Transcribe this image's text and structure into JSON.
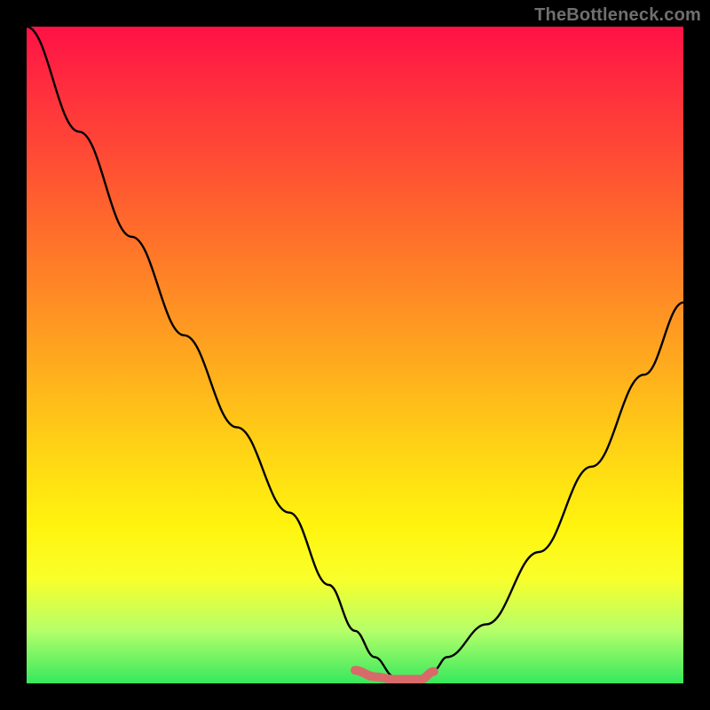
{
  "watermark": "TheBottleneck.com",
  "chart_data": {
    "type": "line",
    "title": "",
    "xlabel": "",
    "ylabel": "",
    "xlim": [
      0,
      100
    ],
    "ylim": [
      0,
      100
    ],
    "grid": false,
    "legend": false,
    "series": [
      {
        "name": "bottleneck-curve",
        "x": [
          0,
          8,
          16,
          24,
          32,
          40,
          46,
          50,
          53,
          56,
          60,
          62,
          64,
          70,
          78,
          86,
          94,
          100
        ],
        "values": [
          100,
          84,
          68,
          53,
          39,
          26,
          15,
          8,
          4,
          1,
          1,
          2,
          4,
          9,
          20,
          33,
          47,
          58
        ]
      },
      {
        "name": "sweet-range-marker",
        "x": [
          50,
          53,
          56,
          60,
          62
        ],
        "values": [
          2,
          1,
          0.6,
          0.6,
          1.8
        ]
      }
    ]
  },
  "colors": {
    "curve": "#000000",
    "marker": "#d86a6a",
    "frame_bg_top": "#ff1146",
    "frame_bg_bottom": "#36e85e",
    "page_bg": "#000000"
  }
}
